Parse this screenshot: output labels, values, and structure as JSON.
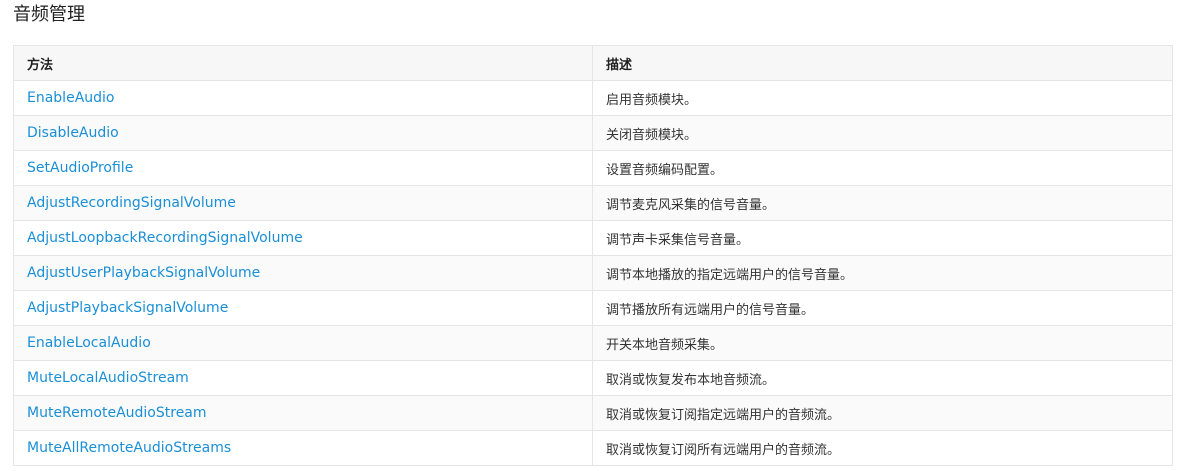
{
  "page": {
    "title": "音频管理"
  },
  "table": {
    "headers": [
      "方法",
      "描述"
    ],
    "rows": [
      {
        "method": "EnableAudio",
        "description": "启用音频模块。"
      },
      {
        "method": "DisableAudio",
        "description": "关闭音频模块。"
      },
      {
        "method": "SetAudioProfile",
        "description": "设置音频编码配置。"
      },
      {
        "method": "AdjustRecordingSignalVolume",
        "description": "调节麦克风采集的信号音量。"
      },
      {
        "method": "AdjustLoopbackRecordingSignalVolume",
        "description": "调节声卡采集信号音量。"
      },
      {
        "method": "AdjustUserPlaybackSignalVolume",
        "description": "调节本地播放的指定远端用户的信号音量。"
      },
      {
        "method": "AdjustPlaybackSignalVolume",
        "description": "调节播放所有远端用户的信号音量。"
      },
      {
        "method": "EnableLocalAudio",
        "description": "开关本地音频采集。"
      },
      {
        "method": "MuteLocalAudioStream",
        "description": "取消或恢复发布本地音频流。"
      },
      {
        "method": "MuteRemoteAudioStream",
        "description": "取消或恢复订阅指定远端用户的音频流。"
      },
      {
        "method": "MuteAllRemoteAudioStreams",
        "description": "取消或恢复订阅所有远端用户的音频流。"
      }
    ]
  },
  "colors": {
    "link": "#1a8fd6",
    "text": "#333333",
    "header_bg": "#f7f7f7",
    "border": "#e5e5e5"
  }
}
